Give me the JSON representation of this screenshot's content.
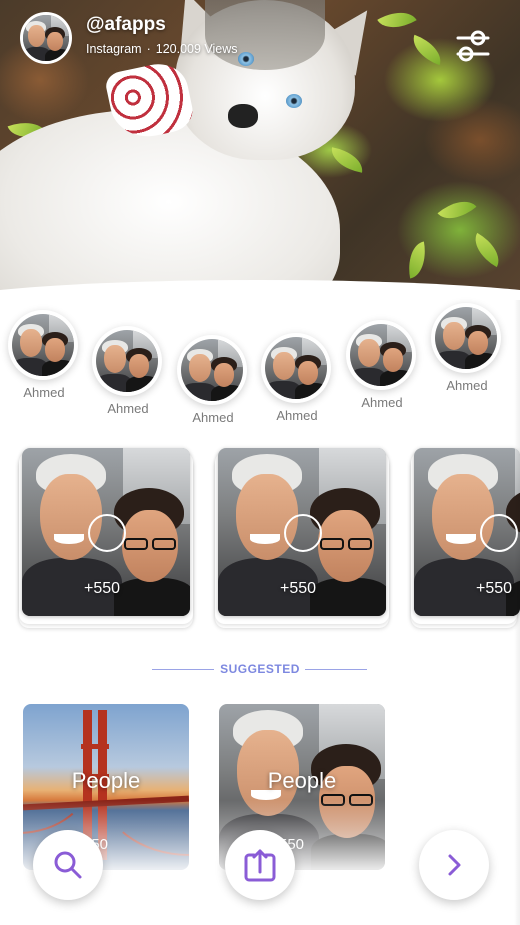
{
  "profile": {
    "handle": "@afapps",
    "source": "Instagram",
    "separator": "·",
    "views": "120.009 Views"
  },
  "icons": {
    "settings": "settings-sliders-icon",
    "search": "search-icon",
    "upload": "upload-icon",
    "next": "chevron-right-icon"
  },
  "stories": [
    {
      "name": "Ahmed"
    },
    {
      "name": "Ahmed"
    },
    {
      "name": "Ahmed"
    },
    {
      "name": "Ahmed"
    },
    {
      "name": "Ahmed"
    },
    {
      "name": "Ahmed"
    }
  ],
  "albums": [
    {
      "count": "+550"
    },
    {
      "count": "+550"
    },
    {
      "count": "+550"
    }
  ],
  "suggested": {
    "label": "SUGGESTED",
    "items": [
      {
        "title": "People",
        "count": "550"
      },
      {
        "title": "People",
        "count": "550"
      }
    ]
  },
  "colors": {
    "accent": "#8a5cd6",
    "suggested": "#7d88e0"
  }
}
